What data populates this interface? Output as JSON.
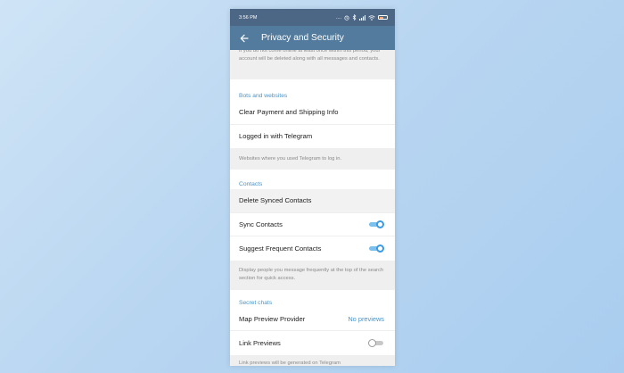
{
  "status_bar": {
    "time": "3:56 PM",
    "signal_text": "....",
    "icons": [
      "alarm-icon",
      "bluetooth-icon",
      "signal-icon",
      "wifi-icon",
      "battery-icon"
    ]
  },
  "app_bar": {
    "title": "Privacy and Security",
    "back_icon": "arrow-left-icon"
  },
  "account_info": "If you do not come online at least once within this period, your account will be deleted along with all messages and contacts.",
  "bots": {
    "header": "Bots and websites",
    "items": [
      {
        "label": "Clear Payment and Shipping Info"
      },
      {
        "label": "Logged in with Telegram"
      }
    ],
    "footer": "Websites where you used Telegram to log in."
  },
  "contacts": {
    "header": "Contacts",
    "items": [
      {
        "label": "Delete Synced Contacts"
      },
      {
        "label": "Sync Contacts",
        "toggle": true
      },
      {
        "label": "Suggest Frequent Contacts",
        "toggle": true
      }
    ],
    "footer": "Display people you message frequently at the top of the search section for quick access."
  },
  "secret": {
    "header": "Secret chats",
    "items": [
      {
        "label": "Map Preview Provider",
        "value": "No previews"
      },
      {
        "label": "Link Previews",
        "toggle": false
      }
    ],
    "footer": "Link previews will be generated on Telegram"
  },
  "colors": {
    "status_bar": "#4b6785",
    "app_bar": "#527b9d",
    "accent": "#4a93c8",
    "toggle_on": "#3c9ae3"
  }
}
